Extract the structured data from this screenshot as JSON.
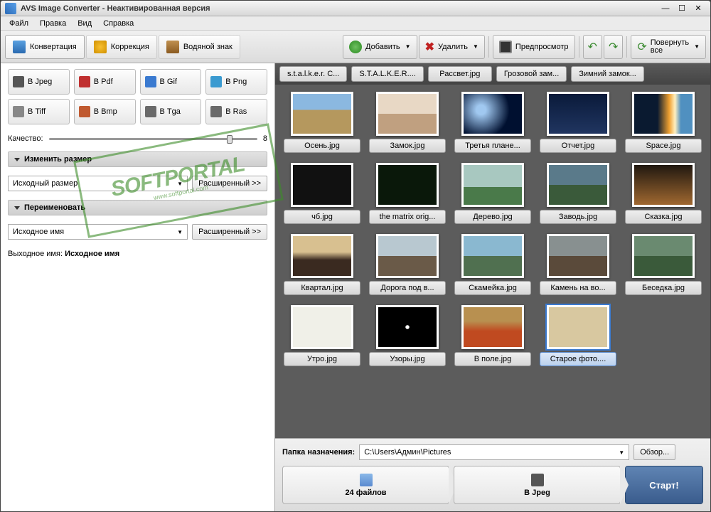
{
  "titlebar": {
    "title": "AVS Image Converter - Неактивированная версия"
  },
  "menu": {
    "file": "Файл",
    "edit": "Правка",
    "view": "Вид",
    "help": "Справка"
  },
  "tabs": {
    "convert": "Конвертация",
    "correction": "Коррекция",
    "watermark": "Водяной знак"
  },
  "toolbar": {
    "add": "Добавить",
    "delete": "Удалить",
    "preview": "Предпросмотр",
    "rotate_line1": "Повернуть",
    "rotate_line2": "все"
  },
  "formats": {
    "jpeg": "В Jpeg",
    "pdf": "В Pdf",
    "gif": "В Gif",
    "png": "В Png",
    "tiff": "В Tiff",
    "bmp": "В Bmp",
    "tga": "В Tga",
    "ras": "В Ras"
  },
  "quality": {
    "label": "Качество:",
    "value": "8"
  },
  "resize": {
    "header": "Изменить размер",
    "selected": "Исходный размер",
    "advanced": "Расширенный >>"
  },
  "rename": {
    "header": "Переименовать",
    "selected": "Исходное имя",
    "advanced": "Расширенный >>",
    "out_label": "Выходное имя:",
    "out_value": "Исходное имя"
  },
  "headers": [
    "s.t.a.l.k.e.r. C...",
    "S.T.A.L.K.E.R....",
    "Рассвет.jpg",
    "Грозовой зам...",
    "Зимний замок..."
  ],
  "thumbs": [
    "Осень.jpg",
    "Замок.jpg",
    "Третья плане...",
    "Отчет.jpg",
    "Space.jpg",
    "чб.jpg",
    "the matrix orig...",
    "Дерево.jpg",
    "Заводь.jpg",
    "Сказка.jpg",
    "Квартал.jpg",
    "Дорога под в...",
    "Скамейка.jpg",
    "Камень на во...",
    "Беседка.jpg",
    "Утро.jpg",
    "Узоры.jpg",
    "В поле.jpg",
    "Старое фото...."
  ],
  "selected_index": 18,
  "dest": {
    "label": "Папка назначения:",
    "path": "C:\\Users\\Админ\\Pictures",
    "browse": "Обзор..."
  },
  "footer": {
    "step1_line2": "24 файлов",
    "step2_line2": "В Jpeg",
    "start": "Старт!"
  },
  "watermark": {
    "brand": "SOFTPORTAL",
    "url": "www.softportal.com"
  }
}
